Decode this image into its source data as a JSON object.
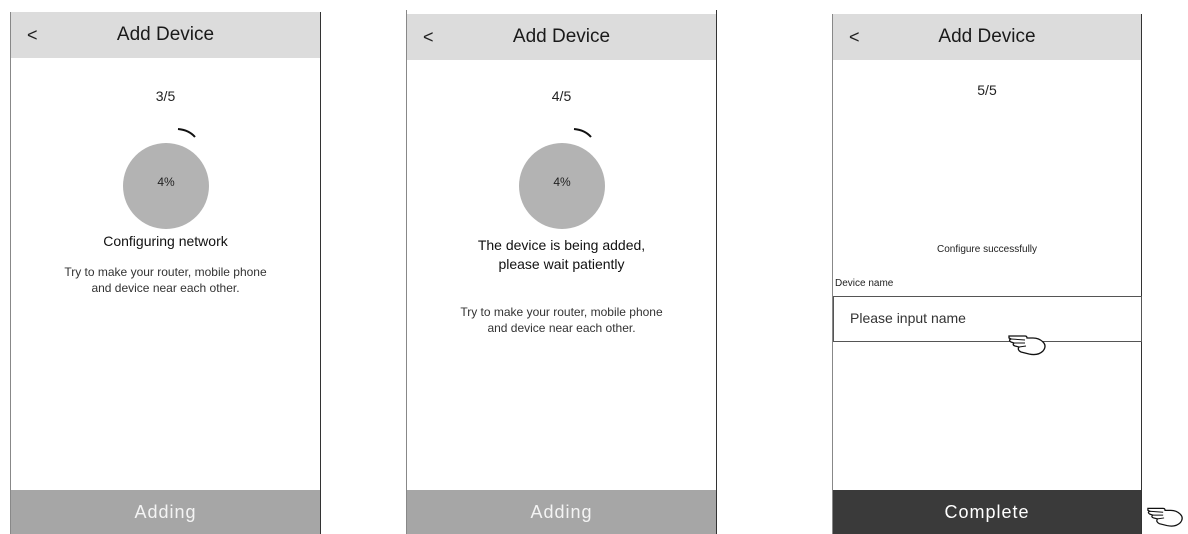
{
  "screens": [
    {
      "back": "<",
      "title": "Add Device",
      "step": "3/5",
      "progress_label": "4%",
      "progress": 0.04,
      "message_line1": "Configuring network",
      "tip_line1": "Try to make your router, mobile phone",
      "tip_line2": "and device near each other.",
      "footer": "Adding"
    },
    {
      "back": "<",
      "title": "Add Device",
      "step": "4/5",
      "progress_label": "4%",
      "progress": 0.04,
      "message_line1": "The device is being added,",
      "message_line2": "please wait patiently",
      "tip_line1": "Try to make your router, mobile phone",
      "tip_line2": "and device near each other.",
      "footer": "Adding"
    },
    {
      "back": "<",
      "title": "Add Device",
      "step": "5/5",
      "success": "Configure successfully",
      "device_name_label": "Device name",
      "input_placeholder": "Please input name",
      "footer": "Complete"
    }
  ],
  "icons": [
    "hand-pointer-icon"
  ],
  "colors": {
    "header": "#dcdcdc",
    "progress_circle": "#b3b3b3",
    "footer_adding": "#a6a6a6",
    "footer_complete": "#3a3a3a"
  }
}
